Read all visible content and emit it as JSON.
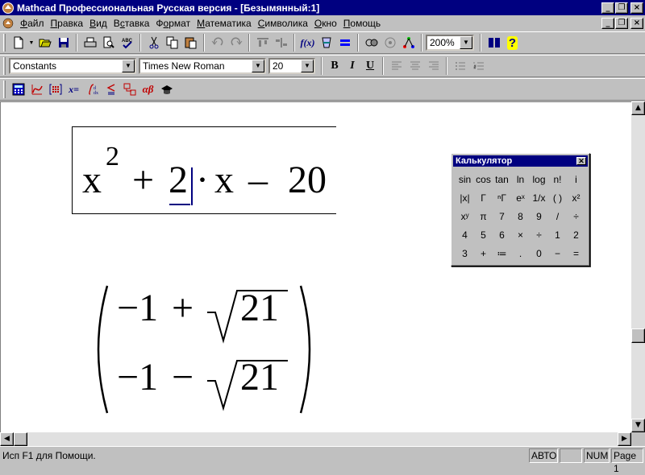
{
  "window": {
    "title": "Mathcad Профессиональная Русская версия - [Безымянный:1]",
    "caption_buttons": [
      "_",
      "❐",
      "×"
    ]
  },
  "menu": {
    "items": [
      {
        "pre": "",
        "u": "Ф",
        "post": "айл"
      },
      {
        "pre": "",
        "u": "П",
        "post": "равка"
      },
      {
        "pre": "",
        "u": "В",
        "post": "ид"
      },
      {
        "pre": "В",
        "u": "с",
        "post": "тавка"
      },
      {
        "pre": "Ф",
        "u": "о",
        "post": "рмат"
      },
      {
        "pre": "",
        "u": "М",
        "post": "атематика"
      },
      {
        "pre": "",
        "u": "С",
        "post": "имволика"
      },
      {
        "pre": "",
        "u": "О",
        "post": "кно"
      },
      {
        "pre": "",
        "u": "П",
        "post": "омощь"
      }
    ]
  },
  "toolbar": {
    "zoom": "200%",
    "icons": [
      "new-doc-icon",
      "open-icon",
      "save-icon",
      "print-icon",
      "print-preview-icon",
      "spell-check-icon",
      "cut-icon",
      "copy-icon",
      "paste-icon",
      "undo-icon",
      "redo-icon",
      "align-top-icon",
      "align-down-icon",
      "insert-function-icon",
      "insert-unit-icon",
      "calculate-icon",
      "component-icon",
      "resource-icon",
      "help-icon"
    ]
  },
  "format_bar": {
    "style": "Constants",
    "font": "Times New Roman",
    "size": "20",
    "bold": "B",
    "italic": "I",
    "underline": "U"
  },
  "math_bar": {
    "icons": [
      "calculator-palette-icon",
      "graph-palette-icon",
      "matrix-palette-icon",
      "evaluation-palette-icon",
      "calculus-palette-icon",
      "boolean-palette-icon",
      "programming-palette-icon",
      "greek-palette-icon",
      "symbolic-palette-icon"
    ],
    "evaluation_label": "x=",
    "greek_label": "αβ"
  },
  "worksheet": {
    "expr1": {
      "x": "x",
      "exp": "2",
      "plus": "+",
      "two": "2",
      "dot": "·",
      "x2": "x",
      "minus": "–",
      "twenty": "20"
    },
    "matrix": {
      "row1": {
        "neg": "−1",
        "op": "+",
        "rad": "21"
      },
      "row2": {
        "neg": "−1",
        "op": "−",
        "rad": "21"
      }
    }
  },
  "calculator_palette": {
    "title": "Калькулятор",
    "rows": [
      [
        "sin",
        "cos",
        "tan",
        "ln",
        "log",
        "n!",
        "i"
      ],
      [
        "|x|",
        "Γ",
        "ⁿΓ",
        "eˣ",
        "1/x",
        "( )",
        "x²"
      ],
      [
        "xʸ",
        "π",
        "7",
        "8",
        "9",
        "/",
        "÷"
      ],
      [
        "4",
        "5",
        "6",
        "×",
        "÷",
        "1",
        "2"
      ],
      [
        "3",
        "+",
        "≔",
        ".",
        "0",
        "−",
        "="
      ]
    ]
  },
  "statusbar": {
    "text": "Исп F1 для Помощи.",
    "mode": "АВТО",
    "blank": "",
    "num": "NUM",
    "page": "Page 1"
  }
}
